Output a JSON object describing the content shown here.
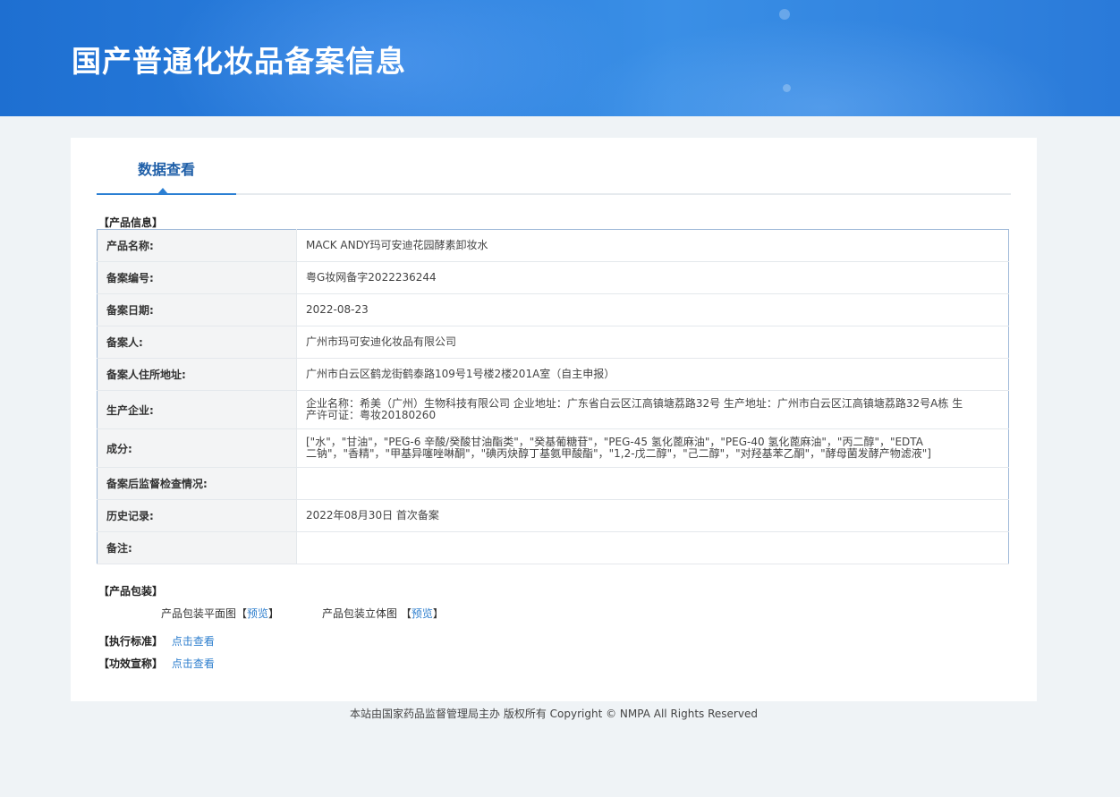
{
  "header": {
    "title": "国产普通化妆品备案信息"
  },
  "tabs": [
    {
      "label": "数据查看"
    }
  ],
  "product_info": {
    "section_label": "【产品信息】",
    "rows": [
      {
        "key": "产品名称:",
        "value": "MACK ANDY玛可安迪花园酵素卸妆水"
      },
      {
        "key": "备案编号:",
        "value": "粤G妆网备字2022236244"
      },
      {
        "key": "备案日期:",
        "value": "2022-08-23"
      },
      {
        "key": "备案人:",
        "value": "广州市玛可安迪化妆品有限公司"
      },
      {
        "key": "备案人住所地址:",
        "value": "广州市白云区鹤龙街鹤泰路109号1号楼2楼201A室（自主申报）"
      },
      {
        "key": "生产企业:",
        "value": "企业名称：希美（广州）生物科技有限公司 企业地址：广东省白云区江高镇塘荔路32号 生产地址：广州市白云区江高镇塘荔路32号A栋 生产许可证：粤妆20180260"
      },
      {
        "key": "成分:",
        "value": "[\"水\"，\"甘油\"，\"PEG-6 辛酸/癸酸甘油酯类\"，\"癸基葡糖苷\"，\"PEG-45 氢化蓖麻油\"，\"PEG-40 氢化蓖麻油\"，\"丙二醇\"，\"EDTA 二钠\"，\"香精\"，\"甲基异噻唑啉酮\"，\"碘丙炔醇丁基氨甲酸酯\"，\"1,2-戊二醇\"，\"己二醇\"，\"对羟基苯乙酮\"，\"酵母菌发酵产物滤液\"]"
      },
      {
        "key": "备案后监督检查情况:",
        "value": ""
      },
      {
        "key": "历史记录:",
        "value": "2022年08月30日 首次备案"
      },
      {
        "key": "备注:",
        "value": ""
      }
    ]
  },
  "packaging": {
    "section_label": "【产品包装】",
    "flat_label": "产品包装平面图",
    "flat_bracket_open": "【",
    "flat_link": "预览",
    "flat_bracket_close": "】",
    "stereo_label": "产品包装立体图 ",
    "stereo_bracket_open": "【",
    "stereo_link": "预览",
    "stereo_bracket_close": "】"
  },
  "standard": {
    "label": "【执行标准】",
    "link": "点击查看"
  },
  "efficacy": {
    "label": "【功效宣称】",
    "link": "点击查看"
  },
  "footer": {
    "text": "本站由国家药品监督管理局主办 版权所有 Copyright © NMPA All Rights Reserved"
  },
  "colors": {
    "banner": "#2b7fde",
    "link": "#2f7fce",
    "tab_active": "#1f5fa8",
    "page_bg": "#eff3f6"
  }
}
